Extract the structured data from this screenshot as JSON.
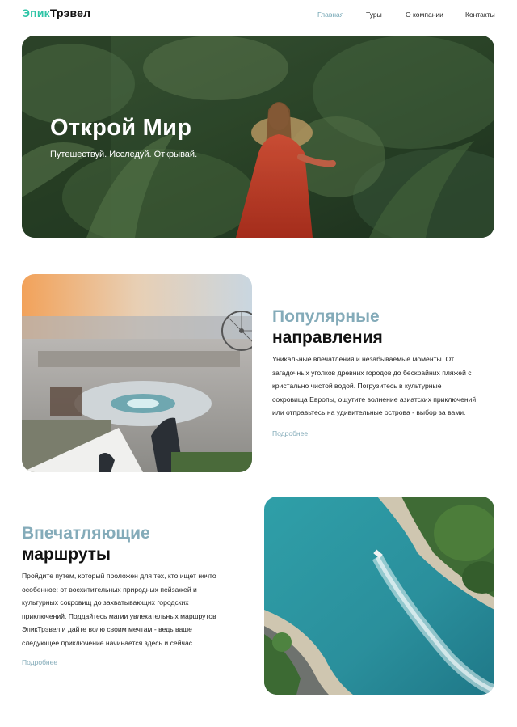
{
  "header": {
    "logo_part1": "Эпик",
    "logo_part2": "Трэвел",
    "nav": [
      {
        "label": "Главная",
        "active": true
      },
      {
        "label": "Туры",
        "active": false
      },
      {
        "label": "О компании",
        "active": false
      },
      {
        "label": "Контакты",
        "active": false
      }
    ]
  },
  "hero": {
    "title": "Открой Мир",
    "subtitle": "Путешествуй. Исследуй. Открывай."
  },
  "section1": {
    "title_line1": "Популярные",
    "title_line2": "направления",
    "text_lines": [
      "Уникальные впечатления и незабываемые моменты. От",
      "загадочных уголков древних городов до бескрайних пляжей с",
      "кристально чистой водой. Погрузитесь в культурные",
      "сокровища Европы, ощутите волнение азиатских приключений,",
      "или отправьтесь на удивительные острова - выбор за вами."
    ],
    "link": "Подробнее"
  },
  "section2": {
    "title_line1": "Впечатляющие",
    "title_line2": "маршруты",
    "text_lines": [
      "Пройдите путем, который проложен для тех, кто ищет нечто",
      "особенное: от восхитительных природных пейзажей и",
      "культурных сокровищ до захватывающих городских",
      "приключений. Поддайтесь магии увлекательных маршрутов",
      "ЭпикТрэвел и дайте волю своим мечтам - ведь ваше",
      "следующее приключение начинается здесь и сейчас."
    ],
    "link": "Подробнее"
  },
  "colors": {
    "accent_logo": "#2ec4a6",
    "heading_accent": "#84abb9",
    "nav_active": "#6fa3b2"
  }
}
